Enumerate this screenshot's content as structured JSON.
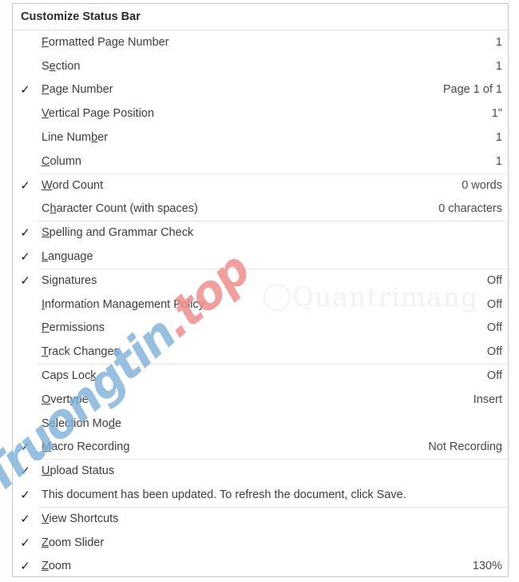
{
  "window": {
    "title": "Customize Status Bar"
  },
  "watermarks": {
    "diagonal_blue": "Truongtin",
    "diagonal_red": ".top",
    "center": "Quantrimang"
  },
  "icons": {
    "check": "✓"
  },
  "menu": {
    "items": [
      {
        "label_pre": "",
        "accel": "F",
        "label_post": "ormatted Page Number",
        "value": "1",
        "checked": false,
        "separator_before": false
      },
      {
        "label_pre": "S",
        "accel": "e",
        "label_post": "ction",
        "value": "1",
        "checked": false,
        "separator_before": false
      },
      {
        "label_pre": "",
        "accel": "P",
        "label_post": "age Number",
        "value": "Page 1 of 1",
        "checked": true,
        "separator_before": false
      },
      {
        "label_pre": "",
        "accel": "V",
        "label_post": "ertical Page Position",
        "value": "1\"",
        "checked": false,
        "separator_before": false
      },
      {
        "label_pre": "Line Num",
        "accel": "b",
        "label_post": "er",
        "value": "1",
        "checked": false,
        "separator_before": false
      },
      {
        "label_pre": "",
        "accel": "C",
        "label_post": "olumn",
        "value": "1",
        "checked": false,
        "separator_before": false
      },
      {
        "label_pre": "",
        "accel": "W",
        "label_post": "ord Count",
        "value": "0 words",
        "checked": true,
        "separator_before": true
      },
      {
        "label_pre": "C",
        "accel": "h",
        "label_post": "aracter Count (with spaces)",
        "value": "0 characters",
        "checked": false,
        "separator_before": false
      },
      {
        "label_pre": "",
        "accel": "S",
        "label_post": "pelling and Grammar Check",
        "value": "",
        "checked": true,
        "separator_before": true
      },
      {
        "label_pre": "",
        "accel": "L",
        "label_post": "anguage",
        "value": "",
        "checked": true,
        "separator_before": false
      },
      {
        "label_pre": "Si",
        "accel": "g",
        "label_post": "natures",
        "value": "Off",
        "checked": true,
        "separator_before": true
      },
      {
        "label_pre": "",
        "accel": "I",
        "label_post": "nformation Management Policy",
        "value": "Off",
        "checked": false,
        "separator_before": false
      },
      {
        "label_pre": "",
        "accel": "P",
        "label_post": "ermissions",
        "value": "Off",
        "checked": false,
        "separator_before": false
      },
      {
        "label_pre": "",
        "accel": "T",
        "label_post": "rack Changes",
        "value": "Off",
        "checked": false,
        "separator_before": false
      },
      {
        "label_pre": "Caps Loc",
        "accel": "k",
        "label_post": "",
        "value": "Off",
        "checked": false,
        "separator_before": true
      },
      {
        "label_pre": "",
        "accel": "O",
        "label_post": "vertype",
        "value": "Insert",
        "checked": false,
        "separator_before": false
      },
      {
        "label_pre": "Selection Mo",
        "accel": "d",
        "label_post": "e",
        "value": "",
        "checked": false,
        "separator_before": false
      },
      {
        "label_pre": "",
        "accel": "M",
        "label_post": "acro Recording",
        "value": "Not Recording",
        "checked": true,
        "separator_before": false
      },
      {
        "label_pre": "",
        "accel": "U",
        "label_post": "pload Status",
        "value": "",
        "checked": true,
        "separator_before": true
      },
      {
        "label_pre": "This document has been updated. To refresh the document, click Save.",
        "accel": "",
        "label_post": "",
        "value": "",
        "checked": true,
        "separator_before": false
      },
      {
        "label_pre": "",
        "accel": "V",
        "label_post": "iew Shortcuts",
        "value": "",
        "checked": true,
        "separator_before": true
      },
      {
        "label_pre": "",
        "accel": "Z",
        "label_post": "oom Slider",
        "value": "",
        "checked": true,
        "separator_before": false
      },
      {
        "label_pre": "",
        "accel": "Z",
        "label_post": "oom",
        "value": "130%",
        "checked": true,
        "separator_before": false
      }
    ]
  }
}
